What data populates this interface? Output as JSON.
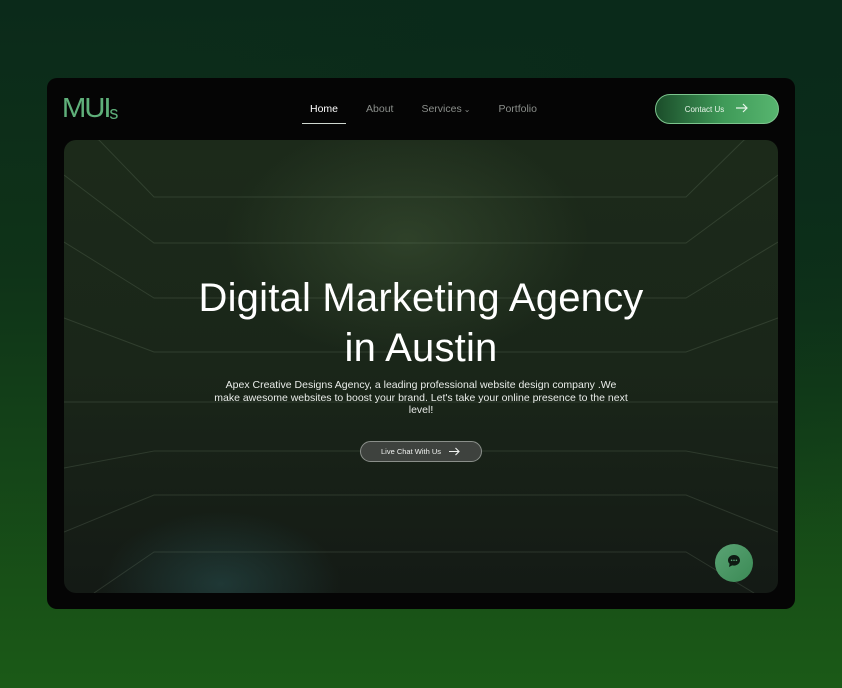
{
  "brand": {
    "logo_main": "MUI",
    "logo_suffix": "s"
  },
  "nav": {
    "items": [
      {
        "label": "Home",
        "active": true
      },
      {
        "label": "About",
        "active": false
      },
      {
        "label": "Services",
        "active": false,
        "has_dropdown": true
      },
      {
        "label": "Portfolio",
        "active": false
      }
    ]
  },
  "header": {
    "contact_label": "Contact Us",
    "contact_icon": "arrow-right-icon"
  },
  "hero": {
    "title_line1": "Digital Marketing Agency",
    "title_line2": "in Austin",
    "description": "Apex Creative Designs Agency, a leading professional website design company .We make awesome websites to boost your brand. Let's take your online presence to the next level!",
    "cta_label": "Live Chat With Us",
    "cta_icon": "arrow-right-icon"
  },
  "chat_widget": {
    "icon": "chat-bubble-icon"
  },
  "colors": {
    "accent": "#57b56f",
    "logo": "#5fb07a",
    "window_bg": "#050505",
    "page_bg_top": "#0b2a1a",
    "page_bg_bottom": "#1b5a17"
  }
}
